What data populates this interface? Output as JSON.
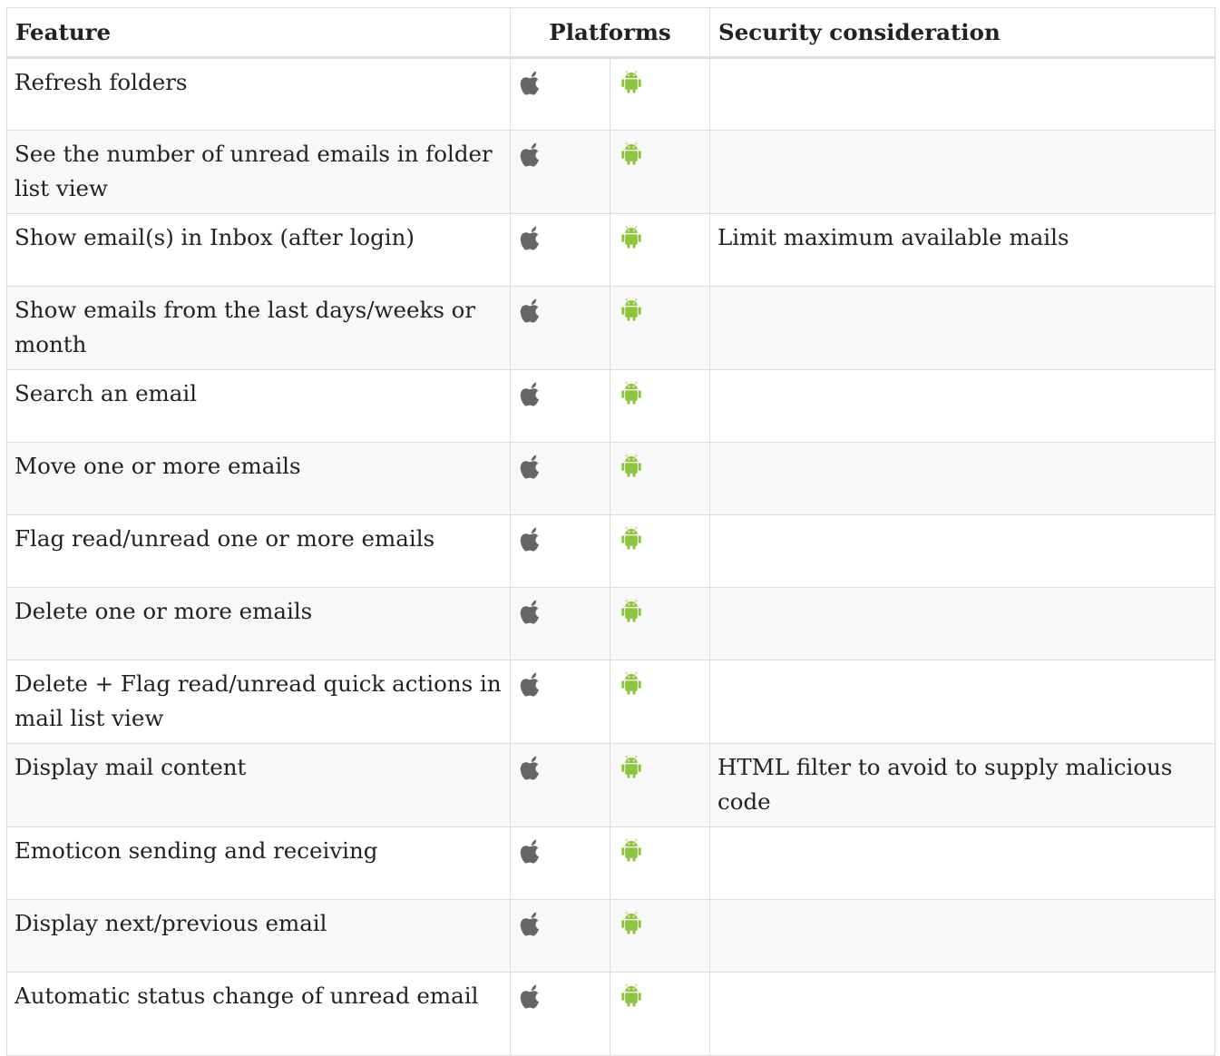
{
  "table": {
    "headers": {
      "feature": "Feature",
      "platforms": "Platforms",
      "security": "Security consideration"
    },
    "icons": {
      "ios": "apple-icon",
      "android": "android-icon"
    },
    "colors": {
      "apple_icon": "#666666",
      "android_icon": "#8cc63e",
      "row_stripe": "#f8f8f8",
      "border": "#dddddd"
    },
    "rows": [
      {
        "feature": "Refresh folders",
        "security": ""
      },
      {
        "feature": "See the number of unread emails in folder list view",
        "security": ""
      },
      {
        "feature": "Show email(s) in Inbox (after login)",
        "security": "Limit maximum available mails"
      },
      {
        "feature": "Show emails from the last days/weeks or month",
        "security": ""
      },
      {
        "feature": "Search an email",
        "security": ""
      },
      {
        "feature": "Move one or more emails",
        "security": ""
      },
      {
        "feature": "Flag read/unread one or more emails",
        "security": ""
      },
      {
        "feature": "Delete one or more emails",
        "security": ""
      },
      {
        "feature": "Delete + Flag read/unread quick actions in mail list view",
        "security": ""
      },
      {
        "feature": "Display mail content",
        "security": "HTML filter to avoid to supply malicious code"
      },
      {
        "feature": "Emoticon sending and receiving",
        "security": ""
      },
      {
        "feature": "Display next/previous email",
        "security": ""
      },
      {
        "feature": "Automatic status change of unread email",
        "security": ""
      }
    ]
  }
}
